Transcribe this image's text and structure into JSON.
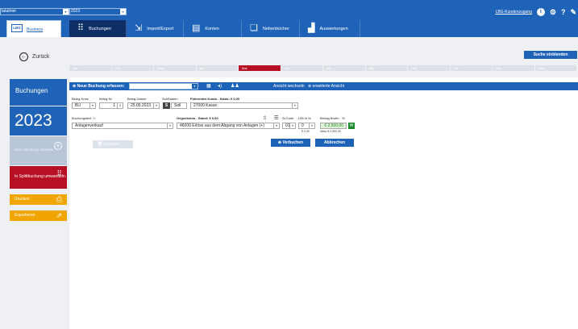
{
  "window": {
    "mandant": "tatalmer",
    "year": "2023"
  },
  "topright": {
    "kundenzugang": "LBG-Kundenzugang",
    "info_icon": "info-icon",
    "gear_icon": "gear-icon",
    "help_icon": "help-icon",
    "help_char": "?"
  },
  "logo": {
    "box": "LBG",
    "text": "Business"
  },
  "tabs": [
    {
      "label": "Buchungen",
      "icon": "split-icon",
      "glyph": "⠿"
    },
    {
      "label": "Import/Export",
      "icon": "import-icon",
      "glyph": "⇲"
    },
    {
      "label": "Konten",
      "icon": "accounts-icon",
      "glyph": "▤"
    },
    {
      "label": "Nebenbücher",
      "icon": "books-icon",
      "glyph": "❏"
    },
    {
      "label": "Auswertungen",
      "icon": "chart-icon",
      "glyph": "▟"
    }
  ],
  "subbar": {
    "back": "Zurück",
    "search_btn": "Suche einblenden"
  },
  "months": [
    "Jan",
    "Feb",
    "März",
    "Apr",
    "Mai",
    "Jun",
    "Jul",
    "Aug",
    "Sep",
    "Okt",
    "Nov",
    "Dez"
  ],
  "active_month": "Mai",
  "left": {
    "title": "Buchungen",
    "year": "2023",
    "new_booking": "Neue Buchung erfassen",
    "split": "In Splittbuchung umwandeln",
    "print": "Drucken",
    "export": "Exportieren"
  },
  "form": {
    "title": "Neue Buchung erfassen:",
    "select_value": "",
    "toggle_view": "Ansicht wechseln",
    "extended_view": "erweiterte Ansicht",
    "labels": {
      "belegkreis": "Beleg-Kreis",
      "belegnr": "Beleg-Nr",
      "belegdatum": "Beleg-Datum",
      "sollhaben": "Soll/Haben",
      "fuehrendes": "Führendes Konto - Saldo: € 0,00",
      "buchungstext": "Buchungstext",
      "buchungstext_count": "31",
      "gegenkonto": "Gegenkonto - Stand: € 0,00",
      "stcode": "St.Code",
      "ust": "USt in %",
      "betrag": "Betrag Brutto",
      "betrag_icon": "%"
    },
    "values": {
      "belegkreis": "BU",
      "belegnr": "1",
      "belegdatum": "25.05.2023",
      "soll_badge": "S",
      "soll_text": "Soll",
      "fuehrendes_konto": "27000 Kasse",
      "buchungstext": "Anlagenverkauf",
      "gegenkonto": "46000 Erlöse aus dem Abgang von Anlagen (+)",
      "stcode": "01",
      "ust": "0",
      "ust_amount": "€ 0,00",
      "betrag": "€ 2.500,00",
      "betrag_badge": "H",
      "netto": "Netto € 2.500,00"
    },
    "buttons": {
      "delete": "Löschen",
      "book": "Verbuchen",
      "cancel": "Abbrechen"
    }
  },
  "colors": {
    "primary": "#1f63b8",
    "dark": "#0d2f66",
    "red": "#b70f23",
    "orange": "#f0a500",
    "green": "#1a8a2e"
  }
}
